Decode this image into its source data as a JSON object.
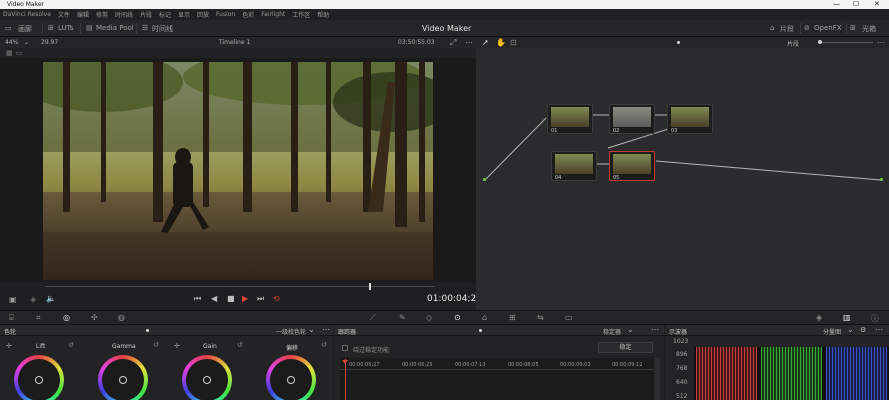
{
  "window": {
    "title": "Video Maker",
    "minimize": "—",
    "maximize": "☐",
    "close": "✕"
  },
  "menu": [
    "DaVinci Resolve",
    "文件",
    "编辑",
    "修剪",
    "时间线",
    "片段",
    "标记",
    "显示",
    "回放",
    "Fusion",
    "色彩",
    "Fairlight",
    "工作区",
    "帮助"
  ],
  "toolbar": {
    "gallery": "画廊",
    "luts": "LUTs",
    "media_pool": "Media Pool",
    "timeline": "时间线",
    "project_title": "Video Maker",
    "clips": "片段",
    "nodes": "节点",
    "openfx": "OpenFX",
    "lightbox": "光箱"
  },
  "viewer": {
    "zoom": "44%",
    "fps": "29.97",
    "timeline_name": "Timeline 1",
    "timecode_top": "03:50:55:03",
    "timecode": "01:00:04;22"
  },
  "nodes": {
    "mode": "片段",
    "items": [
      {
        "id": "01"
      },
      {
        "id": "02"
      },
      {
        "id": "03"
      },
      {
        "id": "04"
      },
      {
        "id": "05"
      }
    ]
  },
  "color_panel": {
    "title": "色轮",
    "mode": "一级校色轮",
    "wheels": [
      "Lift",
      "Gamma",
      "Gain",
      "偏移"
    ]
  },
  "tracker": {
    "title": "跟踪器",
    "mode": "稳定器",
    "bypass_label": "绕过稳定功能",
    "stabilize_button": "稳定",
    "ruler": [
      "00:00:05:27",
      "00:00:06:25",
      "00:00:07:13",
      "00:00:08:05",
      "00:00:09:03",
      "00:00:09:12"
    ]
  },
  "scopes": {
    "title": "示波器",
    "mode": "分量图",
    "scale": [
      "1023",
      "896",
      "768",
      "640",
      "512"
    ],
    "colors": {
      "red": "#e04848",
      "green": "#40c040",
      "blue": "#4a62e6"
    }
  }
}
